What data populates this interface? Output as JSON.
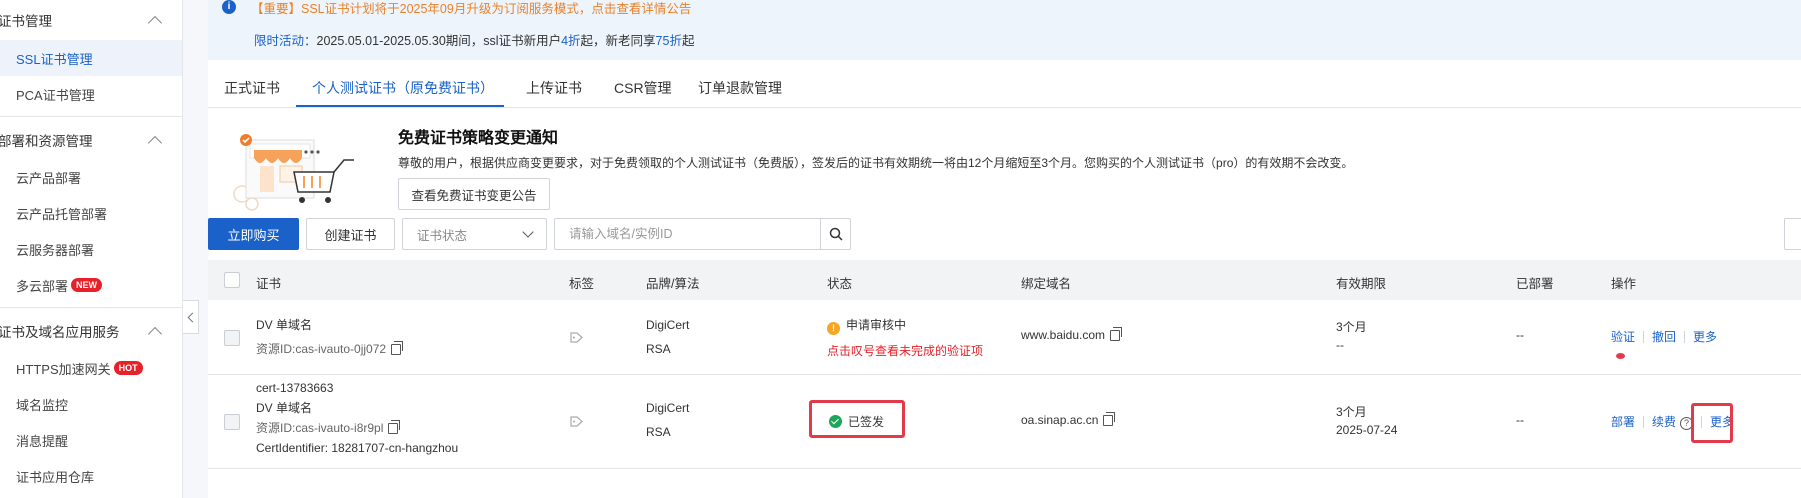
{
  "sidebar": {
    "groups": [
      {
        "label": "证书管理",
        "items": [
          {
            "label": "SSL证书管理",
            "active": true
          },
          {
            "label": "PCA证书管理"
          }
        ]
      },
      {
        "label": "部署和资源管理",
        "items": [
          {
            "label": "云产品部署"
          },
          {
            "label": "云产品托管部署"
          },
          {
            "label": "云服务器部署"
          },
          {
            "label": "多云部署",
            "badge": "NEW"
          }
        ]
      },
      {
        "label": "证书及域名应用服务",
        "items": [
          {
            "label": "HTTPS加速网关",
            "badge": "HOT"
          },
          {
            "label": "域名监控"
          },
          {
            "label": "消息提醒"
          },
          {
            "label": "证书应用仓库"
          }
        ]
      }
    ]
  },
  "notice": {
    "line1_prefix": "【重要】SSL证书计划将于2025年09月升级为订阅服务模式，点击查看",
    "line1_link": "详情公告",
    "line2_label": "限时活动：",
    "line2_a": "2025.05.01-2025.05.30期间，ssl证书新用户",
    "line2_num1": "4折",
    "line2_b": "起，新老同享",
    "line2_num2": "75折",
    "line2_c": "起"
  },
  "tabs": [
    "正式证书",
    "个人测试证书（原免费证书）",
    "上传证书",
    "CSR管理",
    "订单退款管理"
  ],
  "policy": {
    "title": "免费证书策略变更通知",
    "text": "尊敬的用户，根据供应商变更要求，对于免费领取的个人测试证书（免费版），签发后的证书有效期统一将由12个月缩短至3个月。您购买的个人测试证书（pro）的有效期不会改变。",
    "button": "查看免费证书变更公告"
  },
  "toolbar": {
    "buy": "立即购买",
    "create": "创建证书",
    "status_placeholder": "证书状态",
    "search_placeholder": "请输入域名/实例ID"
  },
  "table": {
    "headers": [
      "证书",
      "标签",
      "品牌/算法",
      "状态",
      "绑定域名",
      "有效期限",
      "已部署",
      "操作"
    ],
    "rows": [
      {
        "cert_type": "DV 单域名",
        "resource_id": "资源ID:cas-ivauto-0jj072",
        "brand": "DigiCert",
        "algo": "RSA",
        "status": "申请审核中",
        "status_hint": "点击叹号查看未完成的验证项",
        "domain": "www.baidu.com",
        "period": "3个月",
        "expire": "--",
        "deployed": "--",
        "actions": [
          "验证",
          "撤回",
          "更多"
        ]
      },
      {
        "cert_name": "cert-13783663",
        "cert_type": "DV 单域名",
        "resource_id": "资源ID:cas-ivauto-i8r9pl",
        "cert_identifier": "CertIdentifier: 18281707-cn-hangzhou",
        "brand": "DigiCert",
        "algo": "RSA",
        "status": "已签发",
        "domain": "oa.sinap.ac.cn",
        "period": "3个月",
        "expire": "2025-07-24",
        "deployed": "--",
        "actions": [
          "部署",
          "续费",
          "更多"
        ]
      }
    ]
  },
  "colors": {
    "primary": "#1a62c9",
    "danger": "#e6212a",
    "warning": "#f5a623",
    "success": "#1ea55b",
    "highlight": "#e33a4b"
  }
}
